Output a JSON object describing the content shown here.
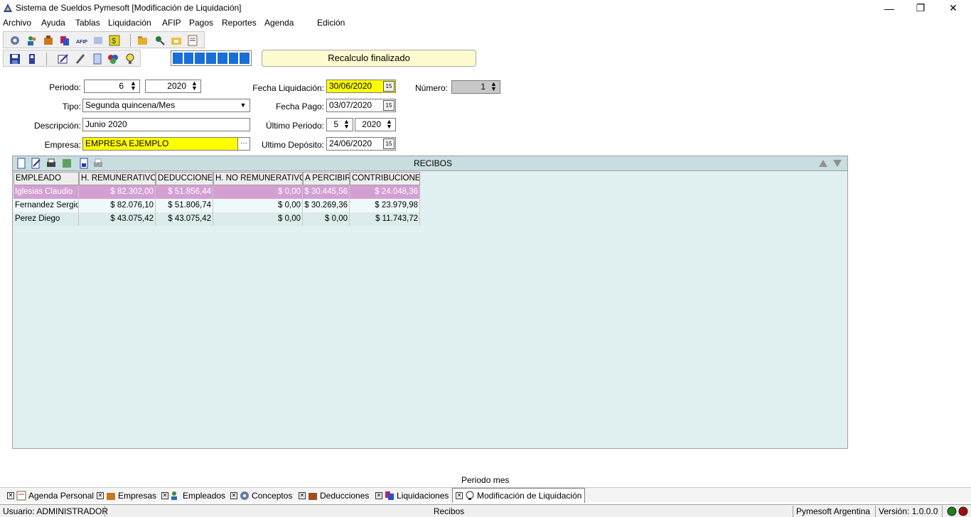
{
  "window": {
    "title": "Sistema de Sueldos Pymesoft [Modificación de Liquidación]",
    "minimize": "—",
    "restore": "❐",
    "close": "✕"
  },
  "menu": [
    "Archivo",
    "Ayuda",
    "Tablas",
    "Liquidación",
    "AFIP",
    "Pagos",
    "Reportes",
    "Agenda",
    "Edición"
  ],
  "status_message": "Recalculo finalizado",
  "form": {
    "periodo_label": "Periodo:",
    "periodo_mes": "6",
    "periodo_anio": "2020",
    "tipo_label": "Tipo:",
    "tipo_value": "Segunda quincena/Mes",
    "descripcion_label": "Descripción:",
    "descripcion_value": "Junio 2020",
    "empresa_label": "Empresa:",
    "empresa_value": "EMPRESA EJEMPLO",
    "empresa_btn": "···",
    "fecha_liq_label": "Fecha Liquidación:",
    "fecha_liq_value": "30/06/2020",
    "fecha_pago_label": "Fecha Pago:",
    "fecha_pago_value": "03/07/2020",
    "ultimo_periodo_label": "Último Periodo:",
    "ultimo_periodo_mes": "5",
    "ultimo_periodo_anio": "2020",
    "ultimo_deposito_label": "Ultimo Depósito:",
    "ultimo_deposito_value": "24/06/2020",
    "numero_label": "Número:",
    "numero_value": "1"
  },
  "recibos": {
    "title": "RECIBOS",
    "columns": [
      "EMPLEADO",
      "H. REMUNERATIVOS",
      "DEDUCCIONES",
      "H. NO REMUNERATIVOS",
      "A PERCIBIR",
      "CONTRIBUCIONES"
    ],
    "rows": [
      [
        "Iglesias Claudio",
        "$ 82.302,00",
        "$ 51.856,44",
        "$ 0,00",
        "$ 30.445,56",
        "$ 24.048,36"
      ],
      [
        "Fernandez Sergio",
        "$ 82.076,10",
        "$ 51.806,74",
        "$ 0,00",
        "$ 30.269,36",
        "$ 23.979,98"
      ],
      [
        "Perez Diego",
        "$ 43.075,42",
        "$ 43.075,42",
        "$ 0,00",
        "$ 0,00",
        "$ 11.743,72"
      ]
    ]
  },
  "footer_label": "Periodo mes",
  "tabs": [
    "Agenda Personal",
    "Empresas",
    "Empleados",
    "Conceptos",
    "Deducciones",
    "Liquidaciones",
    "Modificación de Liquidación"
  ],
  "statusbar": {
    "usuario": "Usuario: ADMINISTRADOR",
    "center": "Recibos",
    "company": "Pymesoft Argentina",
    "version": "Versión: 1.0.0.0"
  },
  "colors": {
    "selected_row": "#d4a0d4",
    "even_row": "#f0fafa",
    "odd_row": "#dcebeb",
    "highlight_field": "#ffff00"
  }
}
